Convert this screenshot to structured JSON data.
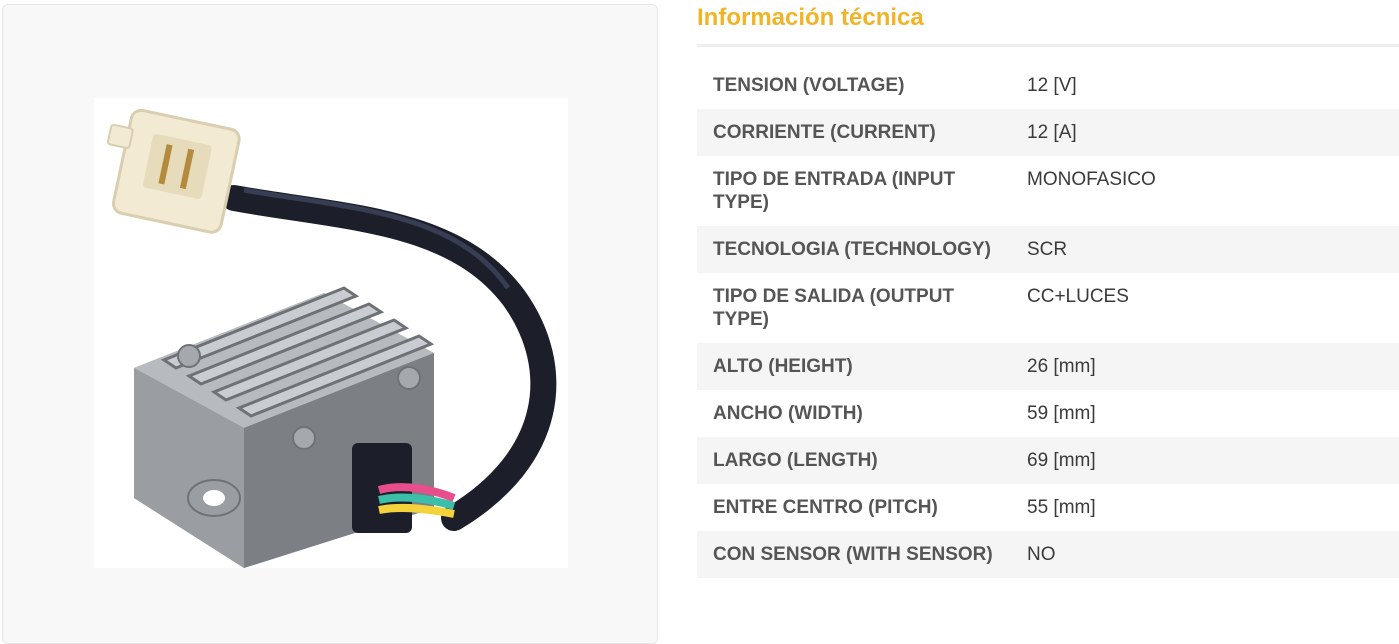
{
  "info": {
    "title": "Información técnica",
    "specs": [
      {
        "label": "TENSION (VOLTAGE)",
        "value": "12 [V]"
      },
      {
        "label": "CORRIENTE (CURRENT)",
        "value": "12 [A]"
      },
      {
        "label": "TIPO DE ENTRADA (INPUT TYPE)",
        "value": "MONOFASICO"
      },
      {
        "label": "TECNOLOGIA (TECHNOLOGY)",
        "value": "SCR"
      },
      {
        "label": "TIPO DE SALIDA (OUTPUT TYPE)",
        "value": "CC+LUCES"
      },
      {
        "label": "ALTO (HEIGHT)",
        "value": "26 [mm]"
      },
      {
        "label": "ANCHO (WIDTH)",
        "value": "59 [mm]"
      },
      {
        "label": "LARGO (LENGTH)",
        "value": "69 [mm]"
      },
      {
        "label": "ENTRE CENTRO (PITCH)",
        "value": "55 [mm]"
      },
      {
        "label": "CON SENSOR (WITH SENSOR)",
        "value": "NO"
      }
    ]
  },
  "colors": {
    "title": "#f0b429",
    "row_alt": "#f5f5f5",
    "regulator_body": "#9a9ea3",
    "cable": "#1c1f2a",
    "connector": "#f2ead2"
  },
  "product_image": {
    "icon": "voltage-regulator-photo"
  }
}
